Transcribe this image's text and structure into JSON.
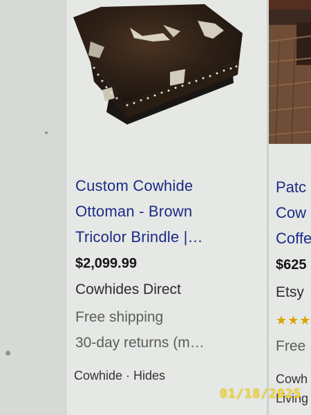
{
  "product_card": {
    "title_lines": [
      "Custom Cowhide",
      "Ottoman - Brown",
      "Tricolor Brindle |…"
    ],
    "price": "$2,099.99",
    "seller": "Cowhides Direct",
    "shipping": "Free shipping",
    "returns": "30-day returns (m…",
    "tags": "Cowhide · Hides"
  },
  "next_card": {
    "title_lines": [
      "Patc",
      "Cow",
      "Coffe"
    ],
    "price": "$625",
    "seller": "Etsy",
    "stars": "★★★",
    "shipping": "Free",
    "tags": [
      "Cowh",
      "Living"
    ]
  },
  "photo_timestamp": "01/18/2025",
  "colors": {
    "title_link": "#1b2a87",
    "star": "#d9a300",
    "timestamp": "#f3d526"
  }
}
